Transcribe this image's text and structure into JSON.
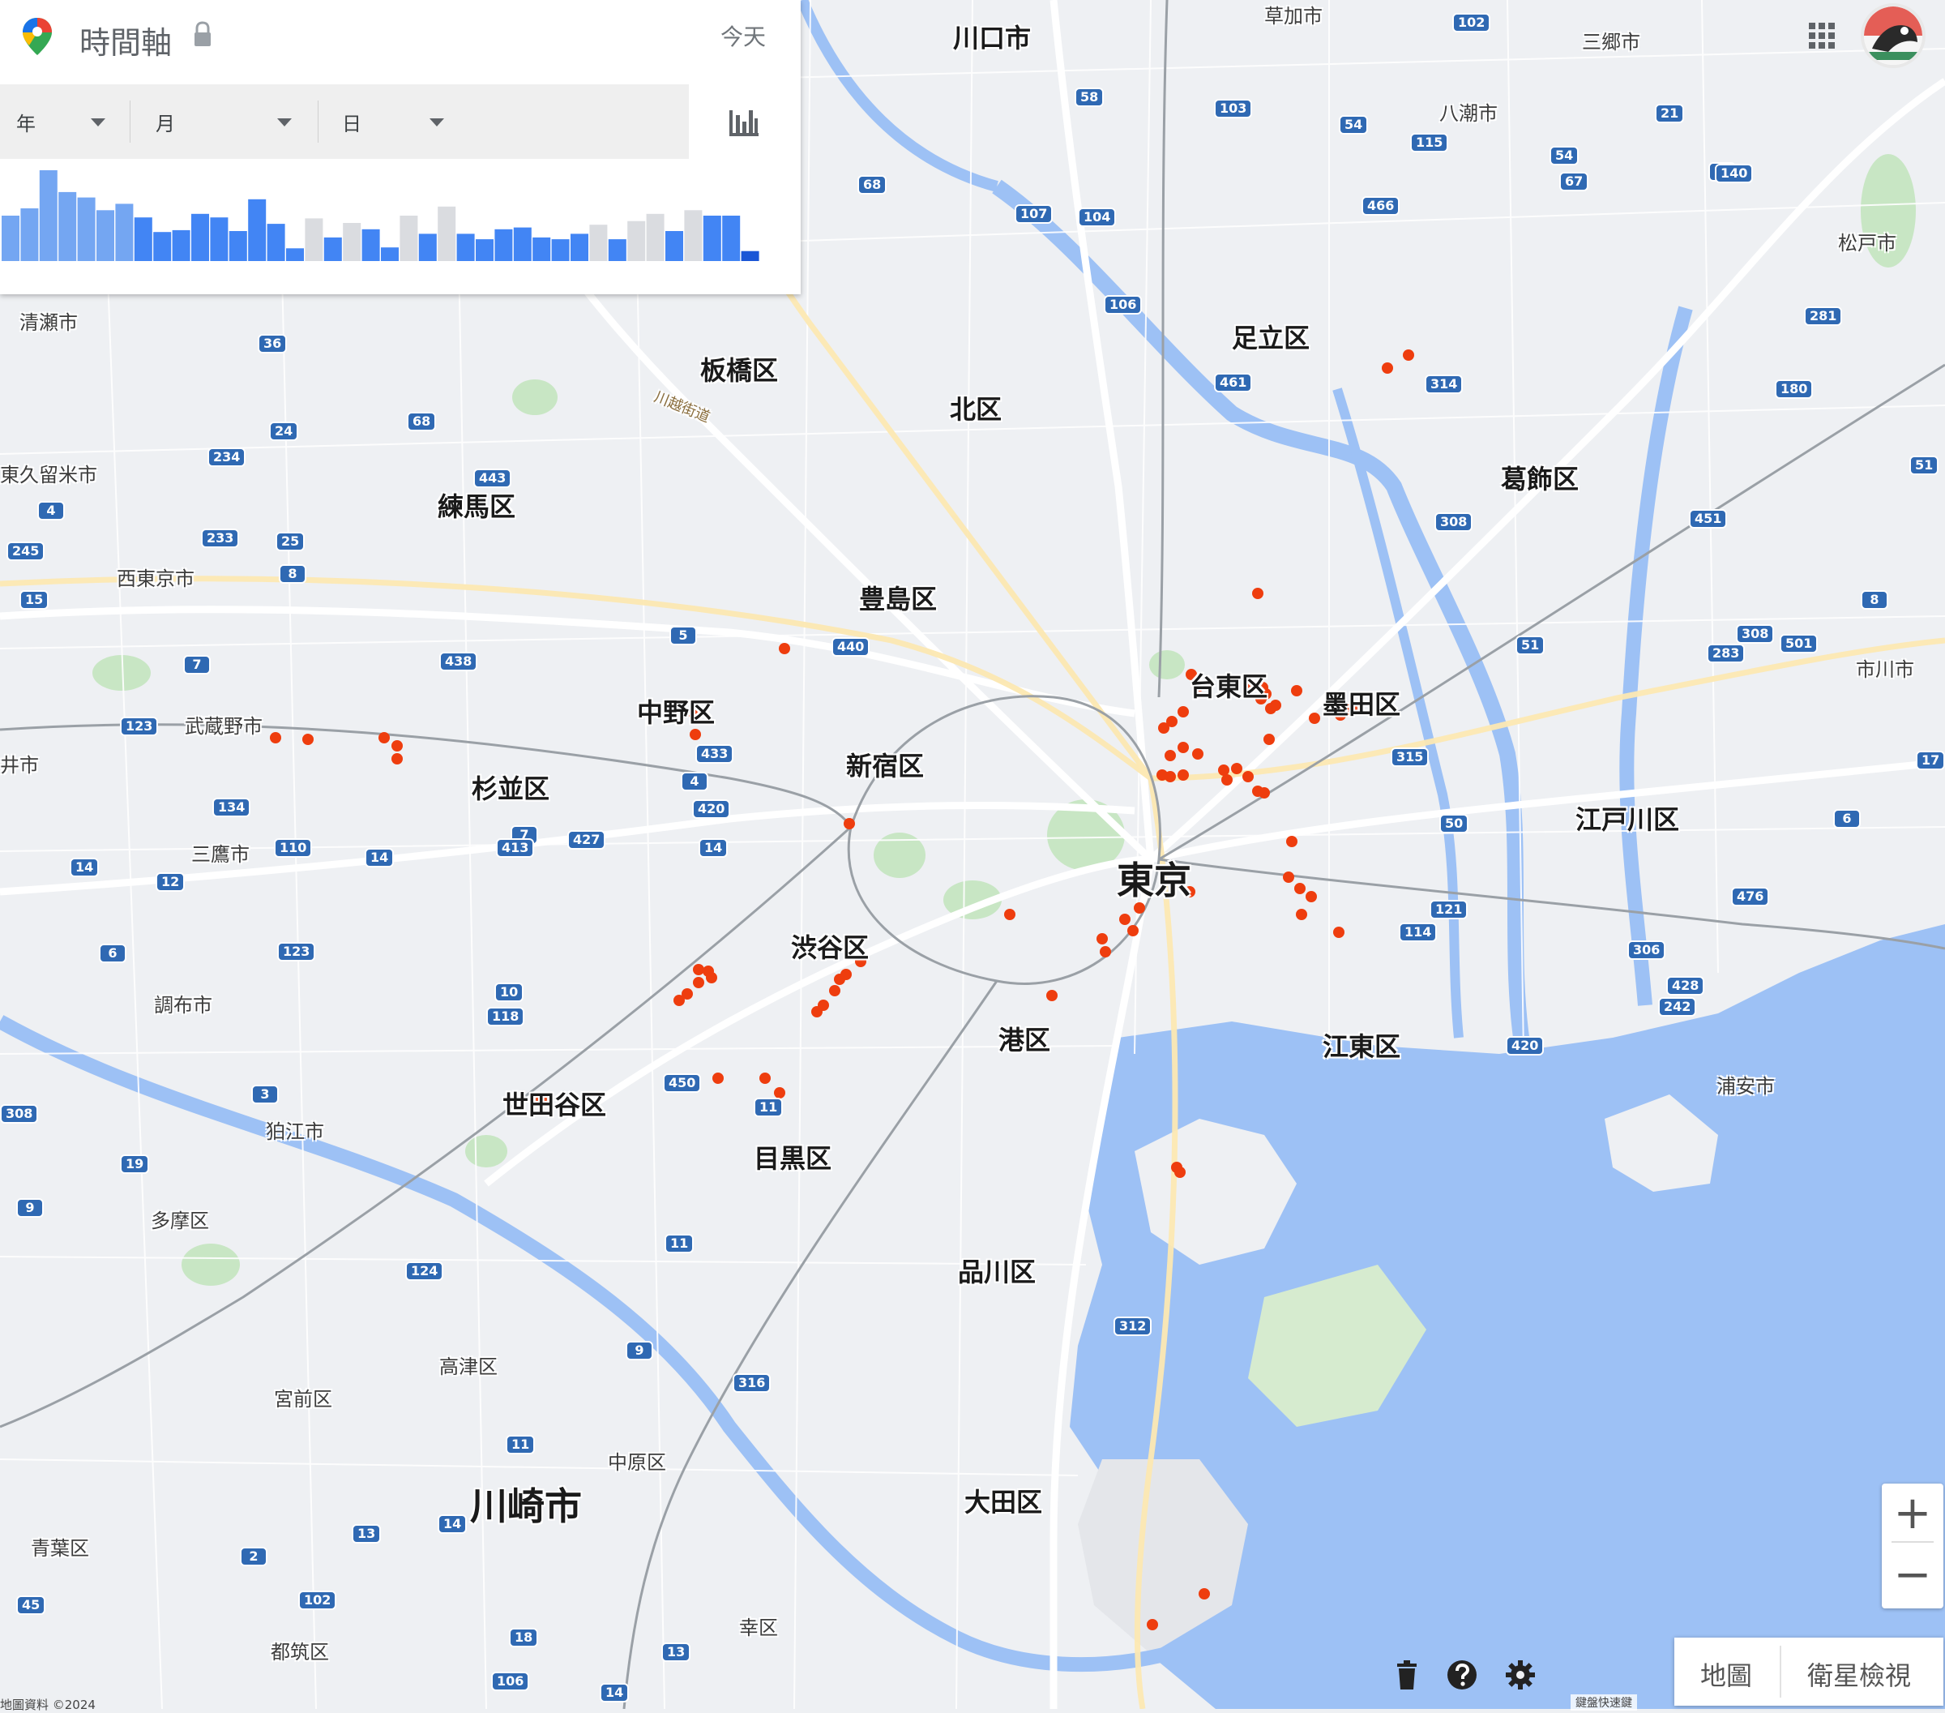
{
  "panel": {
    "title": "時間軸",
    "today_label": "今天",
    "year_label": "年",
    "month_label": "月",
    "day_label": "日",
    "histogram": {
      "colors": {
        "active": "#4285f4",
        "dark": "#1a56d6",
        "light": "#74a6f2",
        "inactive": "#dadce0"
      },
      "bars": [
        {
          "h": 0.5,
          "c": "light"
        },
        {
          "h": 0.58,
          "c": "light"
        },
        {
          "h": 1.0,
          "c": "light"
        },
        {
          "h": 0.76,
          "c": "light"
        },
        {
          "h": 0.7,
          "c": "light"
        },
        {
          "h": 0.56,
          "c": "light"
        },
        {
          "h": 0.63,
          "c": "light"
        },
        {
          "h": 0.48,
          "c": "active"
        },
        {
          "h": 0.32,
          "c": "active"
        },
        {
          "h": 0.34,
          "c": "active"
        },
        {
          "h": 0.52,
          "c": "active"
        },
        {
          "h": 0.48,
          "c": "active"
        },
        {
          "h": 0.33,
          "c": "active"
        },
        {
          "h": 0.68,
          "c": "active"
        },
        {
          "h": 0.41,
          "c": "active"
        },
        {
          "h": 0.14,
          "c": "active"
        },
        {
          "h": 0.47,
          "c": "inactive"
        },
        {
          "h": 0.26,
          "c": "active"
        },
        {
          "h": 0.42,
          "c": "inactive"
        },
        {
          "h": 0.35,
          "c": "active"
        },
        {
          "h": 0.15,
          "c": "active"
        },
        {
          "h": 0.5,
          "c": "inactive"
        },
        {
          "h": 0.3,
          "c": "active"
        },
        {
          "h": 0.6,
          "c": "inactive"
        },
        {
          "h": 0.3,
          "c": "active"
        },
        {
          "h": 0.24,
          "c": "active"
        },
        {
          "h": 0.35,
          "c": "active"
        },
        {
          "h": 0.37,
          "c": "active"
        },
        {
          "h": 0.26,
          "c": "active"
        },
        {
          "h": 0.24,
          "c": "active"
        },
        {
          "h": 0.3,
          "c": "active"
        },
        {
          "h": 0.4,
          "c": "inactive"
        },
        {
          "h": 0.24,
          "c": "active"
        },
        {
          "h": 0.44,
          "c": "inactive"
        },
        {
          "h": 0.52,
          "c": "inactive"
        },
        {
          "h": 0.33,
          "c": "active"
        },
        {
          "h": 0.56,
          "c": "inactive"
        },
        {
          "h": 0.5,
          "c": "active"
        },
        {
          "h": 0.5,
          "c": "active"
        },
        {
          "h": 0.11,
          "c": "dark"
        }
      ]
    }
  },
  "map": {
    "colors": {
      "land": "#eef0f3",
      "water": "#9dc1f5",
      "green": "#c8e6c4",
      "road": "#ffffff",
      "rail": "#9aa0a6",
      "expressway": "#fce8b2",
      "marker": "#ee3d0e"
    },
    "labels": [
      {
        "t": "川口市",
        "cls": "ward"
      },
      {
        "t": "草加市",
        "cls": "city"
      },
      {
        "t": "三郷市",
        "cls": "city"
      },
      {
        "t": "八潮市",
        "cls": "city"
      },
      {
        "t": "松戸市",
        "cls": "city"
      },
      {
        "t": "清瀬市",
        "cls": "city"
      },
      {
        "t": "足立区",
        "cls": "ward"
      },
      {
        "t": "板橋区",
        "cls": "ward"
      },
      {
        "t": "北区",
        "cls": "ward"
      },
      {
        "t": "葛飾区",
        "cls": "ward"
      },
      {
        "t": "東久留米市",
        "cls": "city"
      },
      {
        "t": "練馬区",
        "cls": "ward"
      },
      {
        "t": "西東京市",
        "cls": "city"
      },
      {
        "t": "豊島区",
        "cls": "ward"
      },
      {
        "t": "台東区",
        "cls": "ward"
      },
      {
        "t": "墨田区",
        "cls": "ward"
      },
      {
        "t": "市川市",
        "cls": "city"
      },
      {
        "t": "武蔵野市",
        "cls": "city"
      },
      {
        "t": "中野区",
        "cls": "ward"
      },
      {
        "t": "新宿区",
        "cls": "ward"
      },
      {
        "t": "杉並区",
        "cls": "ward"
      },
      {
        "t": "江戸川区",
        "cls": "ward"
      },
      {
        "t": "東京",
        "cls": "big"
      },
      {
        "t": "三鷹市",
        "cls": "city"
      },
      {
        "t": "渋谷区",
        "cls": "ward"
      },
      {
        "t": "調布市",
        "cls": "city"
      },
      {
        "t": "港区",
        "cls": "ward"
      },
      {
        "t": "江東区",
        "cls": "ward"
      },
      {
        "t": "世田谷区",
        "cls": "ward"
      },
      {
        "t": "目黒区",
        "cls": "ward"
      },
      {
        "t": "狛江市",
        "cls": "city"
      },
      {
        "t": "浦安市",
        "cls": "city"
      },
      {
        "t": "多摩区",
        "cls": "city"
      },
      {
        "t": "品川区",
        "cls": "ward"
      },
      {
        "t": "高津区",
        "cls": "city"
      },
      {
        "t": "宮前区",
        "cls": "city"
      },
      {
        "t": "中原区",
        "cls": "city"
      },
      {
        "t": "川崎市",
        "cls": "big"
      },
      {
        "t": "大田区",
        "cls": "ward"
      },
      {
        "t": "青葉区",
        "cls": "city"
      },
      {
        "t": "幸区",
        "cls": "city"
      },
      {
        "t": "都筑区",
        "cls": "city"
      },
      {
        "t": "川越街道",
        "cls": "road"
      },
      {
        "t": "井市",
        "cls": "city"
      }
    ],
    "route_numbers": [
      "102",
      "58",
      "103",
      "54",
      "115",
      "21",
      "54",
      "67",
      "5",
      "466",
      "68",
      "107",
      "104",
      "106",
      "281",
      "461",
      "314",
      "180",
      "51",
      "36",
      "68",
      "24",
      "234",
      "443",
      "451",
      "308",
      "4",
      "233",
      "25",
      "8",
      "245",
      "15",
      "5",
      "440",
      "8",
      "51",
      "308",
      "283",
      "501",
      "438",
      "7",
      "123",
      "433",
      "4",
      "420",
      "315",
      "17",
      "134",
      "7",
      "413",
      "427",
      "14",
      "110",
      "14",
      "50",
      "6",
      "14",
      "12",
      "121",
      "476",
      "6",
      "123",
      "114",
      "306",
      "10",
      "118",
      "428",
      "242",
      "450",
      "3",
      "11",
      "420",
      "308",
      "19",
      "9",
      "11",
      "124",
      "312",
      "9",
      "316",
      "11",
      "2",
      "14",
      "13",
      "45",
      "102",
      "18",
      "13",
      "106",
      "14",
      "140",
      "140",
      "5"
    ]
  },
  "controls": {
    "zoom_in": "+",
    "zoom_out": "−",
    "map_type_map": "地圖",
    "map_type_satellite": "衛星檢視",
    "copyright": "地圖資料 ©2024",
    "shortcuts": "鍵盤快速鍵"
  }
}
